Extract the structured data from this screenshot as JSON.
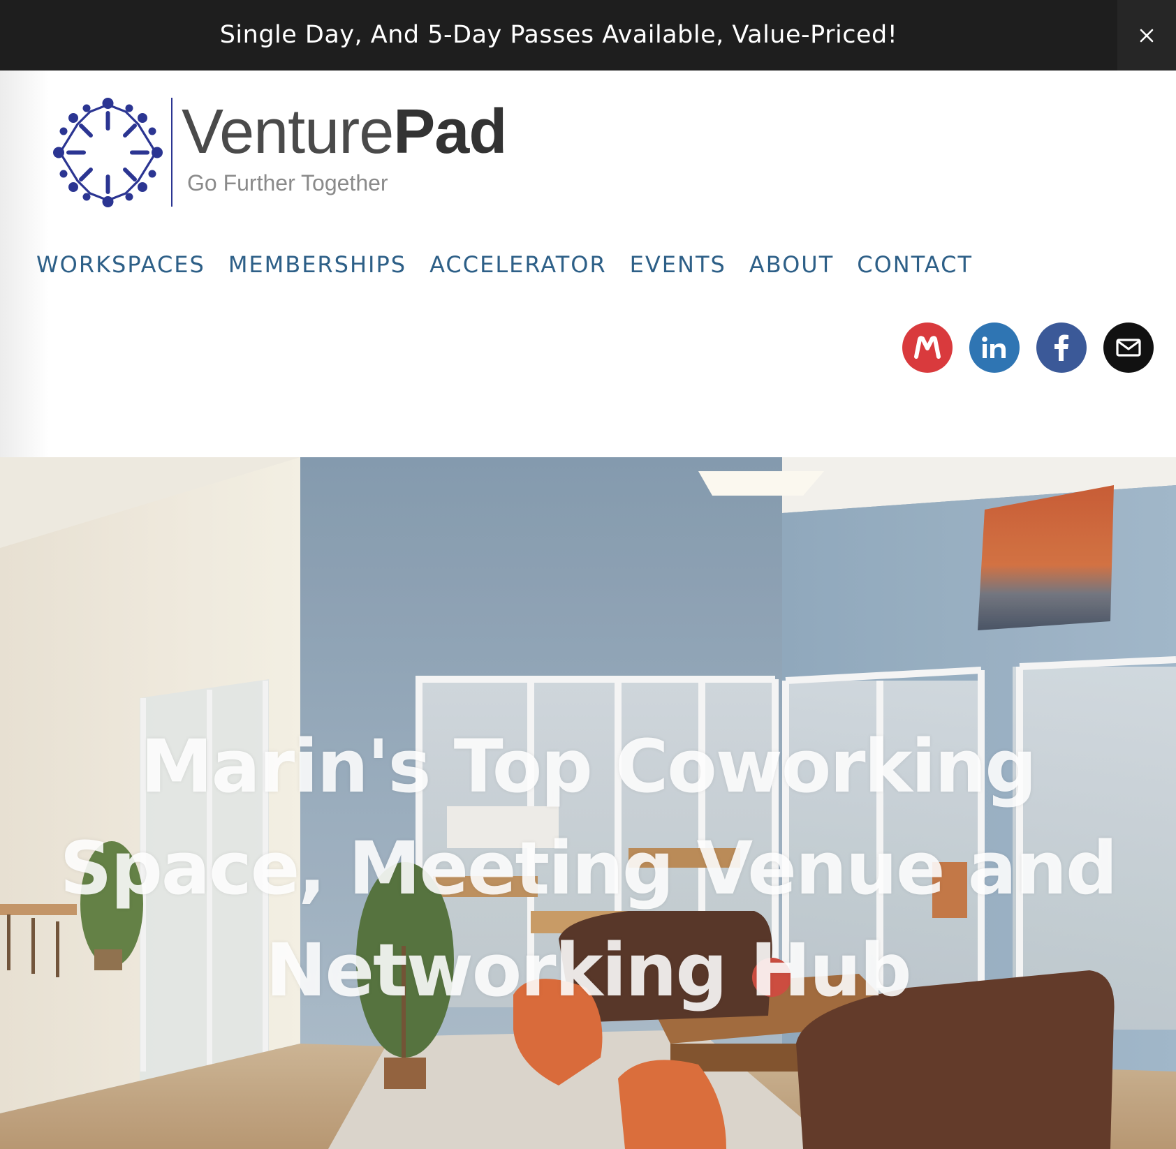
{
  "announcement": {
    "text": "Single Day,  And 5-Day Passes Available, Value-Priced!",
    "close_icon": "close-icon"
  },
  "brand": {
    "name_light": "Venture",
    "name_bold": "Pad",
    "tagline": "Go Further Together",
    "logo_icon": "people-circle-logo-icon",
    "logo_color": "#2b3592"
  },
  "nav": {
    "items": [
      {
        "label": "WORKSPACES"
      },
      {
        "label": "MEMBERSHIPS"
      },
      {
        "label": "ACCELERATOR"
      },
      {
        "label": "EVENTS"
      },
      {
        "label": "ABOUT"
      },
      {
        "label": "CONTACT"
      }
    ],
    "color": "#2d5f87"
  },
  "social": [
    {
      "name": "meetup",
      "icon": "meetup-icon",
      "color": "#d93a3d"
    },
    {
      "name": "linkedin",
      "icon": "linkedin-icon",
      "color": "#2f75b3"
    },
    {
      "name": "facebook",
      "icon": "facebook-icon",
      "color": "#3b5998"
    },
    {
      "name": "email",
      "icon": "email-icon",
      "color": "#111111"
    }
  ],
  "hero": {
    "title": "Marin's Top Coworking Space, Meeting Venue and Networking Hub",
    "image": "coworking-lounge-photo"
  }
}
